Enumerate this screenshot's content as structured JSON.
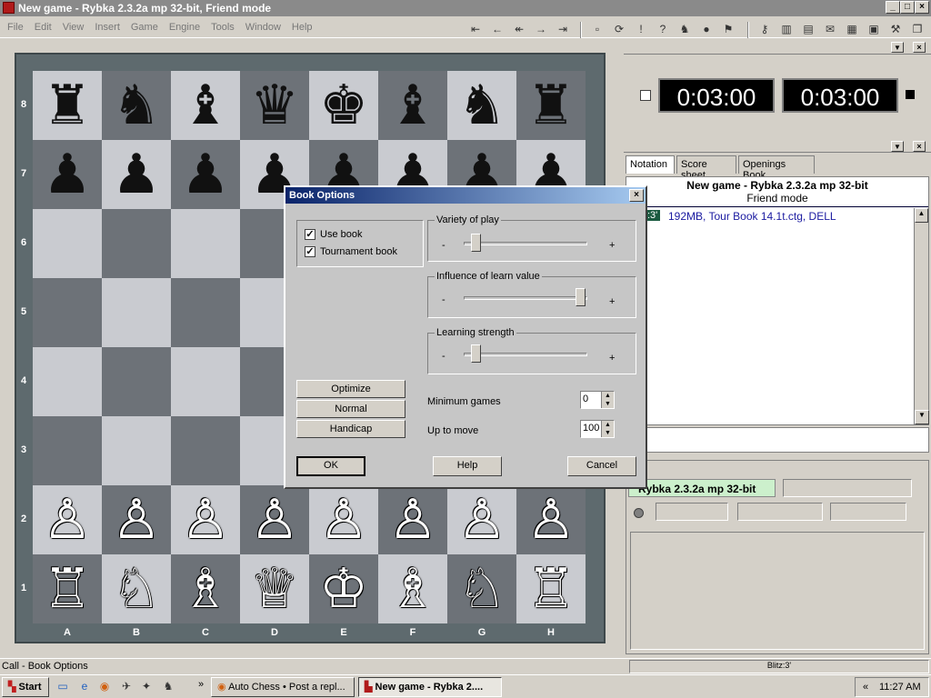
{
  "window": {
    "title": "New game - Rybka 2.3.2a mp 32-bit, Friend mode"
  },
  "menu": [
    "File",
    "Edit",
    "View",
    "Insert",
    "Game",
    "Engine",
    "Tools",
    "Window",
    "Help"
  ],
  "board": {
    "ranks": [
      "8",
      "7",
      "6",
      "5",
      "4",
      "3",
      "2",
      "1"
    ],
    "files": [
      "A",
      "B",
      "C",
      "D",
      "E",
      "F",
      "G",
      "H"
    ],
    "pieces": {
      "r8": [
        "♜",
        "♞",
        "♝",
        "♛",
        "♚",
        "♝",
        "♞",
        "♜"
      ],
      "r7": [
        "♟",
        "♟",
        "♟",
        "♟",
        "♟",
        "♟",
        "♟",
        "♟"
      ],
      "r2": [
        "♙",
        "♙",
        "♙",
        "♙",
        "♙",
        "♙",
        "♙",
        "♙"
      ],
      "r1": [
        "♖",
        "♘",
        "♗",
        "♕",
        "♔",
        "♗",
        "♘",
        "♖"
      ]
    }
  },
  "clocks": {
    "white": "0:03:00",
    "black": "0:03:00"
  },
  "tabs": [
    "Notation",
    "Score sheet",
    "Openings Book"
  ],
  "notation": {
    "title": "New game - Rybka 2.3.2a mp 32-bit",
    "subtitle": "Friend mode",
    "badge": ":3'",
    "book_info": "192MB, Tour Book 14.1t.ctg, DELL"
  },
  "engine": {
    "name": "Rybka 2.3.2a mp 32-bit"
  },
  "dialog": {
    "title": "Book Options",
    "use_book": "Use book",
    "use_book_checked": true,
    "tournament_book": "Tournament book",
    "tournament_book_checked": true,
    "variety_label": "Variety of play",
    "variety_value": 0.05,
    "influence_label": "Influence of learn value",
    "influence_value": 1.0,
    "learning_label": "Learning strength",
    "learning_value": 0.05,
    "minus": "-",
    "plus": "+",
    "optimize": "Optimize",
    "normal": "Normal",
    "handicap": "Handicap",
    "min_games_label": "Minimum games",
    "min_games_value": "0",
    "up_to_move_label": "Up to move",
    "up_to_move_value": "100",
    "ok": "OK",
    "help": "Help",
    "cancel": "Cancel"
  },
  "status": {
    "left": "Call - Book Options",
    "right": "Blitz:3'"
  },
  "taskbar": {
    "start": "Start",
    "chevron": "»",
    "task1": "Auto Chess • Post a repl...",
    "task2": "New game - Rybka 2....",
    "tray_chevron": "«",
    "time": "11:27 AM"
  }
}
